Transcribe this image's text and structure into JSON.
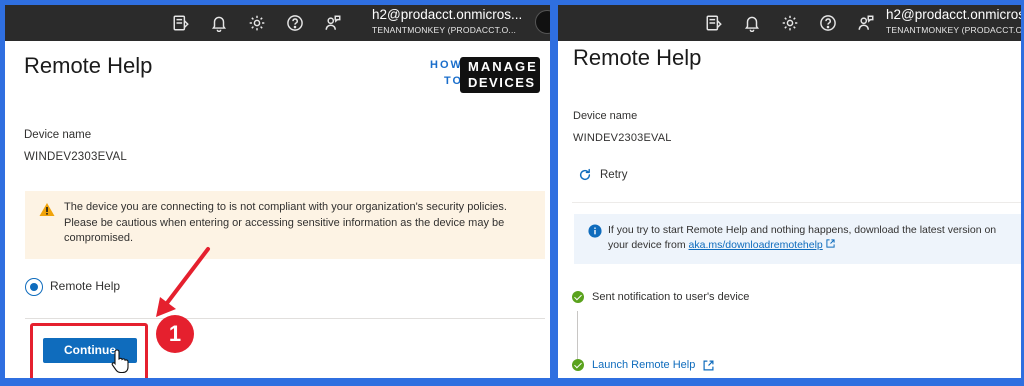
{
  "topbar": {
    "user": "h2@prodacct.onmicros...",
    "tenant": "TENANTMONKEY (PRODACCT.O..."
  },
  "left": {
    "title": "Remote Help",
    "device_name_label": "Device name",
    "device_name_value": "WINDEV2303EVAL",
    "warning_text": "The device you are connecting to is not compliant with your organization's security policies. Please be cautious when entering or accessing sensitive information as the device may be compromised.",
    "radio_label": "Remote Help",
    "continue_label": "Continue",
    "step_number": "1",
    "logo": {
      "how": "HOW",
      "to": "TO",
      "manage": "MANAGE",
      "devices": "DEVICES"
    }
  },
  "right": {
    "topbar": {
      "user": "h2@prodacct.onmicros",
      "tenant": "TENANTMONKEY (PRODACCT.O"
    },
    "title": "Remote Help",
    "device_name_label": "Device name",
    "device_name_value": "WINDEV2303EVAL",
    "retry_label": "Retry",
    "info_text": "If you try to start Remote Help and nothing happens, download the latest version on your device from ",
    "info_link": "aka.ms/downloadremotehelp",
    "step1": "Sent notification to user's device",
    "step2": "Launch Remote Help"
  },
  "icons": [
    "feedback-icon",
    "bell-icon",
    "gear-icon",
    "help-icon",
    "person-feedback-icon",
    "warning-icon",
    "info-icon",
    "retry-icon",
    "check-icon",
    "external-link-icon",
    "hand-cursor-icon"
  ],
  "colors": {
    "accent": "#0f6cbd",
    "annotation_red": "#e5202e",
    "warning_bg": "#fdf3e4",
    "info_bg": "#eef4fb",
    "success": "#5aa21d",
    "frame": "#2f6fe0",
    "topbar": "#2b2b2b"
  }
}
